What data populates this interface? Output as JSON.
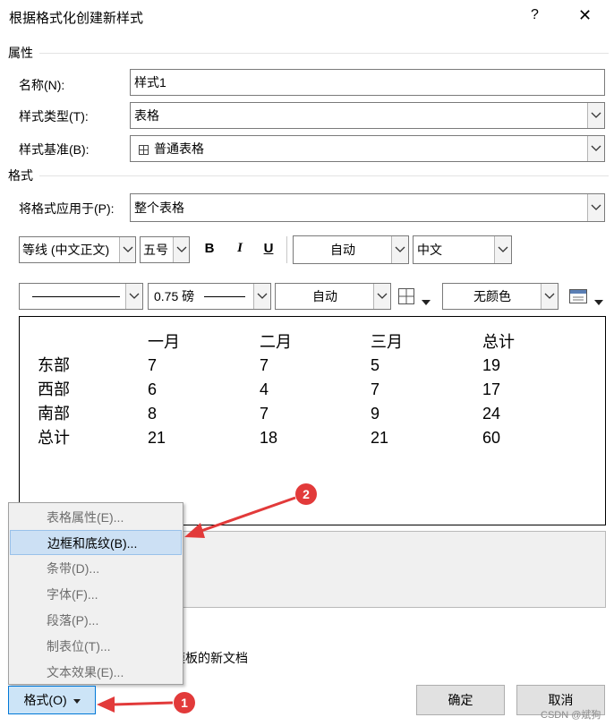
{
  "dialog": {
    "title": "根据格式化创建新样式",
    "help_glyph": "?",
    "close_glyph": "✕"
  },
  "properties": {
    "section": "属性",
    "name_label": "名称(N):",
    "name_value": "样式1",
    "type_label": "样式类型(T):",
    "type_value": "表格",
    "based_label": "样式基准(B):",
    "based_value": "普通表格"
  },
  "format": {
    "section": "格式",
    "apply_label": "将格式应用于(P):",
    "apply_value": "整个表格",
    "font": "等线 (中文正文)",
    "size": "五号",
    "bold": "B",
    "italic": "I",
    "underline": "U",
    "font_color": "自动",
    "script": "中文",
    "border_weight": "0.75 磅",
    "border_color": "自动",
    "shading": "无颜色"
  },
  "preview_table": {
    "headers": [
      "",
      "一月",
      "二月",
      "三月",
      "总计"
    ],
    "rows": [
      [
        "东部",
        "7",
        "7",
        "5",
        "19"
      ],
      [
        "西部",
        "6",
        "4",
        "7",
        "17"
      ],
      [
        "南部",
        "8",
        "7",
        "9",
        "24"
      ],
      [
        "总计",
        "21",
        "18",
        "21",
        "60"
      ]
    ]
  },
  "format_menu": {
    "items": [
      "表格属性(E)...",
      "边框和底纹(B)...",
      "条带(D)...",
      "字体(F)...",
      "段落(P)...",
      "制表位(T)...",
      "文本效果(E)..."
    ],
    "active_index": 1
  },
  "template_option": "基于该模板的新文档",
  "buttons": {
    "format": "格式(O)",
    "ok": "确定",
    "cancel": "取消"
  },
  "annotations": {
    "marker1": "1",
    "marker2": "2",
    "color": "#e23a3a"
  },
  "watermark": "CSDN @斌狗"
}
